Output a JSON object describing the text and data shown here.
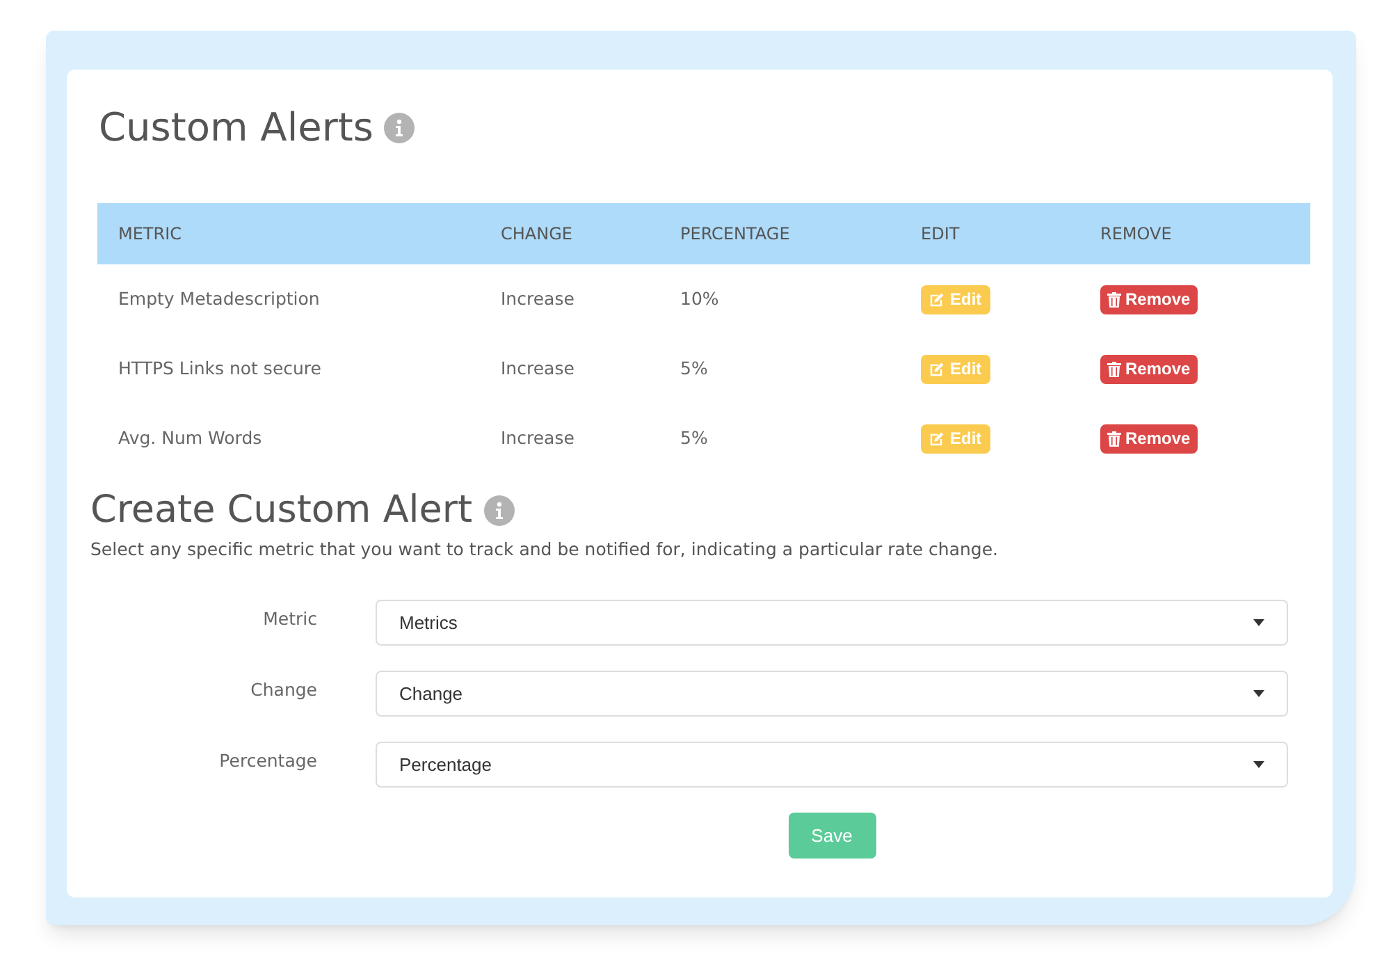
{
  "alerts_section": {
    "title": "Custom Alerts"
  },
  "table": {
    "columns": [
      "METRIC",
      "CHANGE",
      "PERCENTAGE",
      "EDIT",
      "REMOVE"
    ],
    "rows": [
      {
        "metric": "Empty Metadescription",
        "change": "Increase",
        "percentage": "10%",
        "edit": "Edit",
        "remove": "Remove"
      },
      {
        "metric": "HTTPS Links not secure",
        "change": "Increase",
        "percentage": "5%",
        "edit": "Edit",
        "remove": "Remove"
      },
      {
        "metric": "Avg. Num Words",
        "change": "Increase",
        "percentage": "5%",
        "edit": "Edit",
        "remove": "Remove"
      }
    ]
  },
  "create_section": {
    "title": "Create Custom Alert",
    "description": "Select any specific metric that you want to track and be notified for, indicating a particular rate change.",
    "fields": [
      {
        "label": "Metric",
        "value": "Metrics"
      },
      {
        "label": "Change",
        "value": "Change"
      },
      {
        "label": "Percentage",
        "value": "Percentage"
      }
    ],
    "save_button": "Save"
  }
}
